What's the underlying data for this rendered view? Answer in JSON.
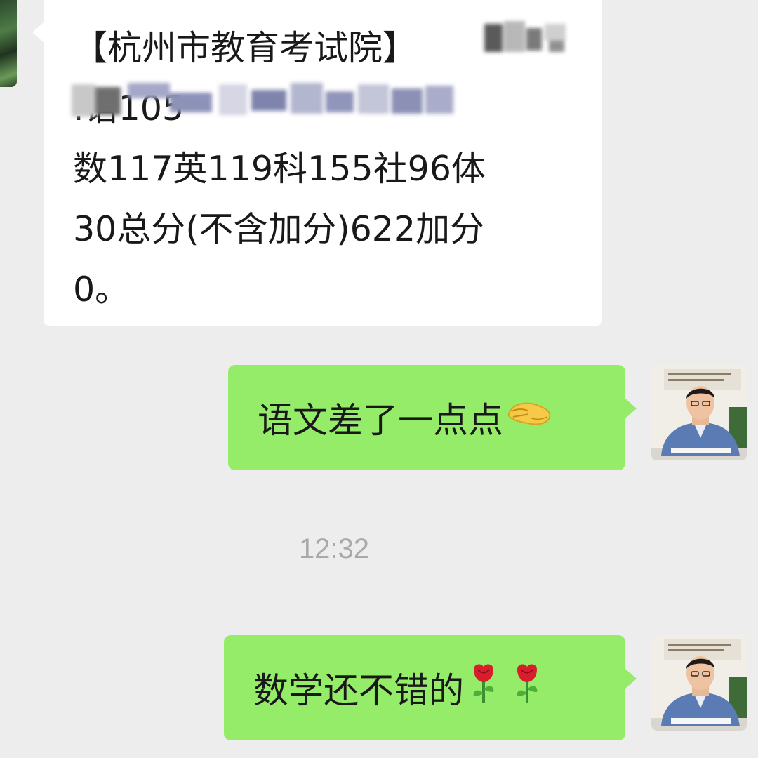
{
  "conversation": {
    "incoming_message": {
      "text": "【杭州市教育考试院】\n                 .语105\n数117英119科155社96体\n30总分(不含加分)622加分\n0。"
    },
    "outgoing_messages": [
      {
        "text": "语文差了一点点",
        "emoji": "pinching-hand-emoji"
      },
      {
        "text": "数学还不错的",
        "emoji": "rose-emoji"
      }
    ],
    "timestamp": "12:32"
  },
  "colors": {
    "background": "#ededed",
    "incoming_bubble": "#ffffff",
    "outgoing_bubble": "#95ec69",
    "timestamp_text": "#a9a9a9"
  }
}
